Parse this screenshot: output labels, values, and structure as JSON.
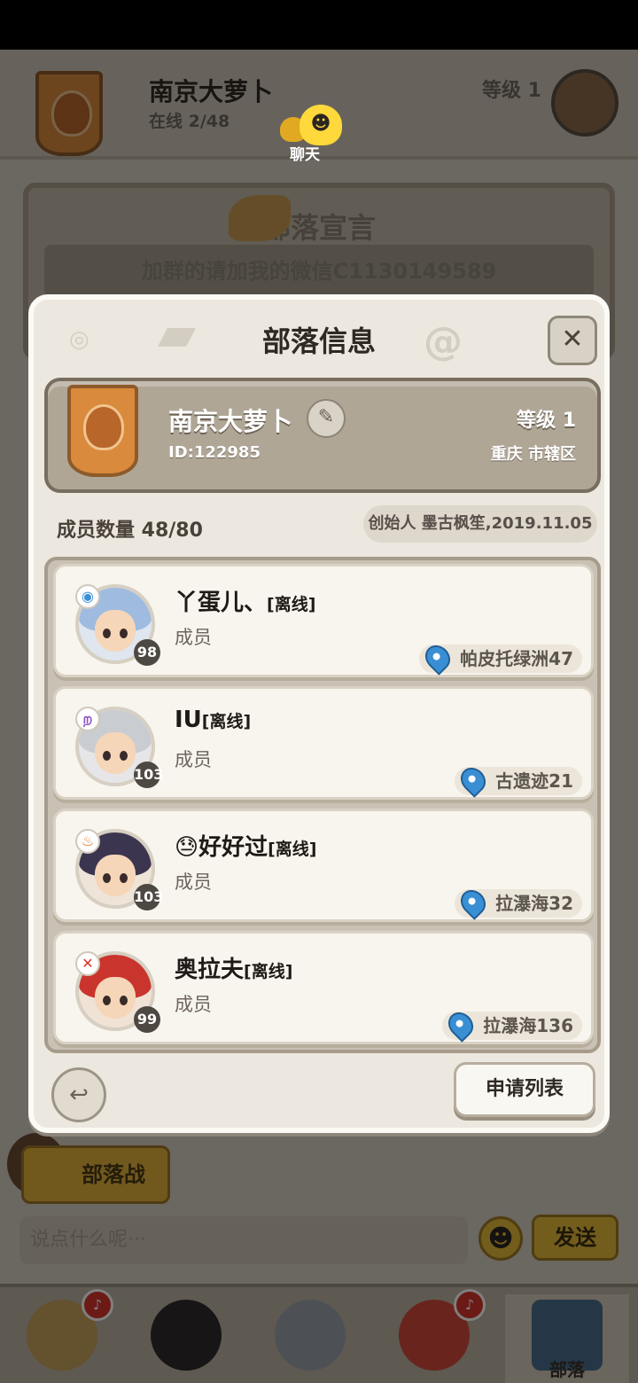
{
  "header": {
    "tribe_name": "南京大萝卜",
    "online": "在线 2/48",
    "level": "等级 1",
    "chat_label": "聊天"
  },
  "declaration": {
    "title": "部落宣言",
    "text": "加群的请加我的微信C1130149589"
  },
  "modal": {
    "title": "部落信息",
    "close_glyph": "✕",
    "tribe": {
      "name": "南京大萝卜",
      "id": "ID:122985",
      "level": "等级 1",
      "region": "重庆 市辖区"
    },
    "member_count": "成员数量 48/80",
    "founder": "创始人 墨古枫笙,2019.11.05",
    "members": [
      {
        "name": "丫蛋儿、",
        "status": "[离线]",
        "role": "成员",
        "level": "98",
        "location": "帕皮托绿洲47",
        "class_icon": "water-class-icon",
        "hair": "#9fbbe0"
      },
      {
        "name": "IU",
        "status": "[离线]",
        "role": "成员",
        "level": "103",
        "location": "古遗迹21",
        "class_icon": "shadow-class-icon",
        "hair": "#c9cdd2"
      },
      {
        "name": "好好过",
        "status": "[离线]",
        "role": "成员",
        "level": "103",
        "location": "拉瀑海32",
        "class_icon": "fire-class-icon",
        "hair": "#3c3550",
        "emoji": "😓"
      },
      {
        "name": "奥拉夫",
        "status": "[离线]",
        "role": "成员",
        "level": "99",
        "location": "拉瀑海136",
        "class_icon": "warrior-class-icon",
        "hair": "#c9352d"
      }
    ],
    "apply_button": "申请列表"
  },
  "bottom": {
    "war_button": "部落战",
    "chat_placeholder": "说点什么呢···",
    "send_button": "发送",
    "nav_active_label": "部落"
  },
  "colors": {
    "accent_orange": "#d98a3c",
    "location_pin": "#3a8fd4",
    "button_yellow": "#e6bb3b"
  }
}
